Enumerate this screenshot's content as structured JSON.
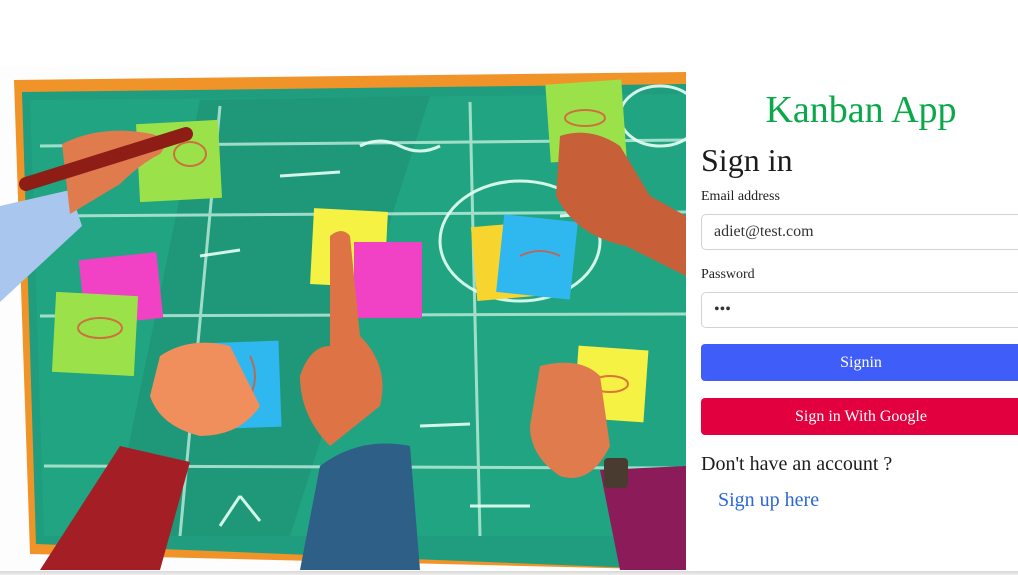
{
  "brand": {
    "title": "Kanban App"
  },
  "form": {
    "heading": "Sign in",
    "email_label": "Email address",
    "email_value": "adiet@test.com",
    "password_label": "Password",
    "password_value": "•••",
    "signin_label": "Signin",
    "google_label": "Sign in With Google",
    "signup_prompt": "Don't have an account ?",
    "signup_link": "Sign up here"
  },
  "colors": {
    "brand": "#0aa84a",
    "primary_button": "#3e5df9",
    "google_button": "#e3003f",
    "link": "#2a67d7",
    "board": "#1f9d7e",
    "board_frame": "#f0942a"
  },
  "illustration": {
    "icon": "kanban-board-illustration"
  }
}
